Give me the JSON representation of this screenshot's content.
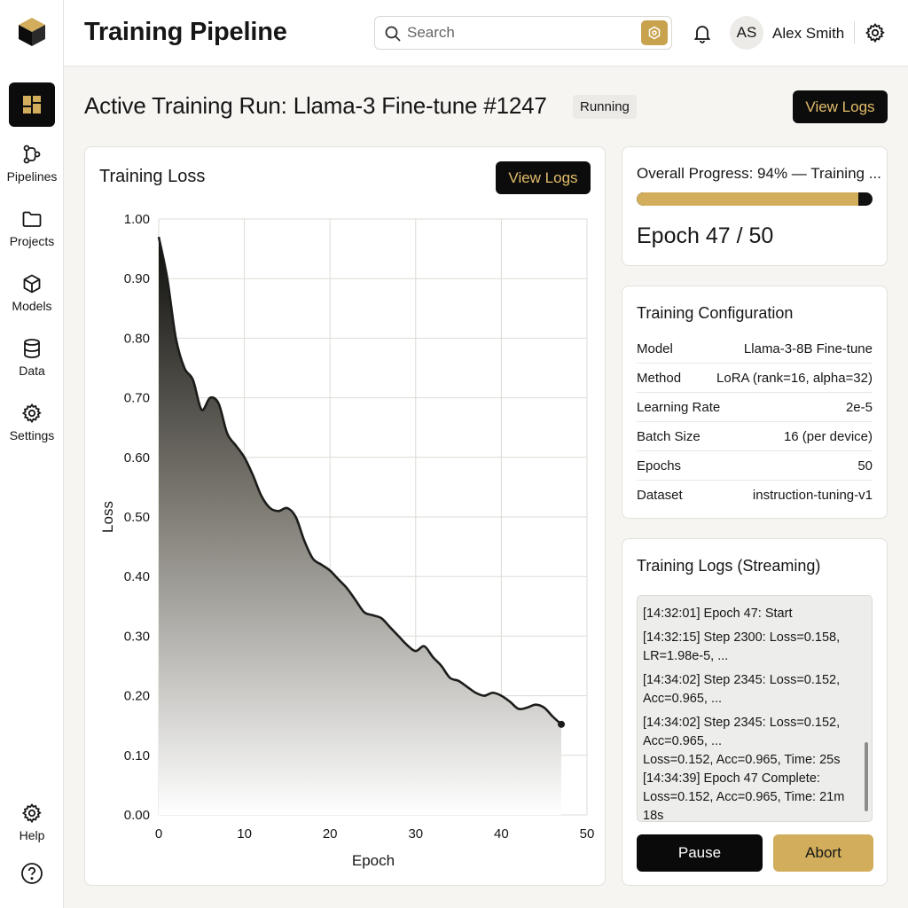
{
  "header": {
    "title": "Training Pipeline",
    "search_placeholder": "Search",
    "user_initials": "AS",
    "user_name": "Alex Smith"
  },
  "sidebar": {
    "items": [
      {
        "label": "Pipelines",
        "icon": "pipeline-icon"
      },
      {
        "label": "Projects",
        "icon": "folder-icon"
      },
      {
        "label": "Models",
        "icon": "cube-icon"
      },
      {
        "label": "Data",
        "icon": "database-icon"
      },
      {
        "label": "Settings",
        "icon": "gear-icon"
      }
    ],
    "help_label": "Help"
  },
  "page": {
    "run_title": "Active Training Run: Llama-3 Fine-tune #1247",
    "status": "Running",
    "view_logs_label": "View Logs"
  },
  "progress": {
    "label": "Overall Progress: 94% — Training ...",
    "percent": 94,
    "epoch_text": "Epoch 47 / 50"
  },
  "config": {
    "title": "Training Configuration",
    "rows": [
      {
        "key": "Model",
        "value": "Llama-3-8B Fine-tune"
      },
      {
        "key": "Method",
        "value": "LoRA (rank=16, alpha=32)"
      },
      {
        "key": "Learning Rate",
        "value": "2e-5"
      },
      {
        "key": "Batch Size",
        "value": "16 (per device)"
      },
      {
        "key": "Epochs",
        "value": "50"
      },
      {
        "key": "Dataset",
        "value": "instruction-tuning-v1"
      }
    ]
  },
  "logs": {
    "title": "Training Logs (Streaming)",
    "entries": [
      "[14:32:01] Epoch 47: Start",
      "[14:32:15] Step 2300: Loss=0.158, LR=1.98e-5, ...",
      "[14:34:02] Step 2345: Loss=0.152, Acc=0.965, ...",
      "[14:34:02] Step 2345: Loss=0.152, Acc=0.965, ...",
      "Loss=0.152, Acc=0.965, Time: 25s",
      "[14:34:39] Epoch 47 Complete: Loss=0.152, Acc=0.965, Time: 21m 18s"
    ],
    "pause_label": "Pause",
    "abort_label": "Abort"
  },
  "colors": {
    "accent_gold": "#d1ad5c",
    "dark": "#0c0c0c",
    "button_text_gold": "#e3bd6a"
  },
  "chart_data": {
    "type": "area",
    "title": "Training Loss",
    "xlabel": "Epoch",
    "ylabel": "Loss",
    "xlim": [
      0,
      50
    ],
    "ylim": [
      0,
      1
    ],
    "xticks": [
      0,
      10,
      20,
      30,
      40,
      50
    ],
    "yticks": [
      "0.00",
      "0.10",
      "0.20",
      "0.30",
      "0.40",
      "0.50",
      "0.60",
      "0.70",
      "0.80",
      "0.90",
      "1.00"
    ],
    "grid": true,
    "x": [
      0,
      1,
      2,
      3,
      4,
      5,
      6,
      7,
      8,
      9,
      10,
      11,
      12,
      13,
      14,
      15,
      16,
      17,
      18,
      19,
      20,
      21,
      22,
      23,
      24,
      25,
      26,
      27,
      28,
      29,
      30,
      31,
      32,
      33,
      34,
      35,
      36,
      37,
      38,
      39,
      40,
      41,
      42,
      43,
      44,
      45,
      46,
      47
    ],
    "y": [
      0.97,
      0.9,
      0.8,
      0.75,
      0.73,
      0.68,
      0.7,
      0.69,
      0.64,
      0.62,
      0.6,
      0.57,
      0.535,
      0.515,
      0.51,
      0.515,
      0.5,
      0.46,
      0.43,
      0.42,
      0.41,
      0.395,
      0.38,
      0.36,
      0.34,
      0.335,
      0.33,
      0.315,
      0.3,
      0.285,
      0.275,
      0.283,
      0.265,
      0.25,
      0.23,
      0.225,
      0.215,
      0.205,
      0.2,
      0.205,
      0.2,
      0.19,
      0.178,
      0.18,
      0.185,
      0.18,
      0.165,
      0.152
    ]
  }
}
